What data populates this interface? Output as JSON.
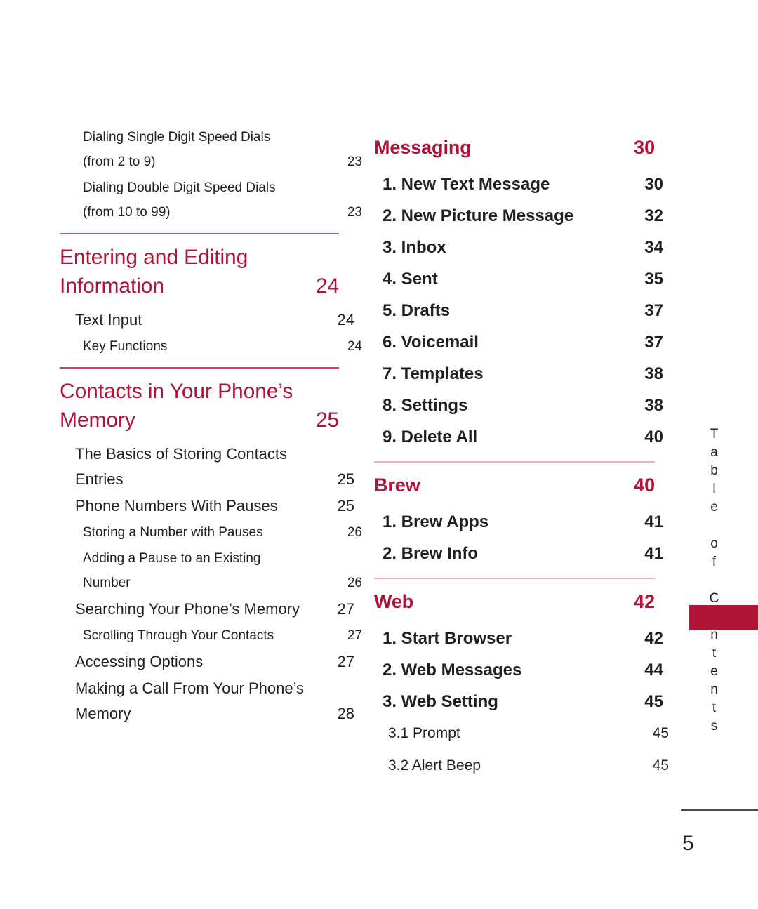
{
  "page": {
    "number": "5",
    "side_tab_label": "Table of Contents",
    "accent_color": "#b01538",
    "rule_color": "#c9456a",
    "light_rule_color": "#efafbc"
  },
  "left_column": [
    {
      "kind": "lv2-wrap",
      "line1": "Dialing Single Digit Speed Dials",
      "line2": "(from 2 to 9)",
      "page": "23"
    },
    {
      "kind": "lv2-wrap",
      "line1": "Dialing Double Digit Speed Dials",
      "line2": "(from 10 to 99)",
      "page": "23"
    },
    {
      "kind": "rule"
    },
    {
      "kind": "section-wrap",
      "line1": "Entering and Editing",
      "line2": "Information",
      "page": "24"
    },
    {
      "kind": "lv1",
      "label": "Text Input",
      "page": "24"
    },
    {
      "kind": "lv2",
      "label": "Key Functions",
      "page": "24"
    },
    {
      "kind": "rule"
    },
    {
      "kind": "section-wrap",
      "line1": "Contacts in Your Phone’s",
      "line2": "Memory",
      "page": "25"
    },
    {
      "kind": "lv1-wrap",
      "line1": "The Basics of Storing Contacts",
      "line2": "Entries",
      "page": "25"
    },
    {
      "kind": "lv1",
      "label": "Phone Numbers With Pauses",
      "page": "25"
    },
    {
      "kind": "lv2",
      "label": "Storing a Number with Pauses",
      "page": "26"
    },
    {
      "kind": "lv2-wrap",
      "line1": "Adding a Pause to an Existing",
      "line2": "Number",
      "page": "26"
    },
    {
      "kind": "lv1",
      "label": "Searching Your Phone’s Memory",
      "page": "27"
    },
    {
      "kind": "lv2",
      "label": "Scrolling Through Your Contacts",
      "page": "27"
    },
    {
      "kind": "lv1",
      "label": "Accessing Options",
      "page": "27"
    },
    {
      "kind": "lv1-wrap",
      "line1": "Making a Call From Your Phone’s",
      "line2": "Memory",
      "page": "28"
    }
  ],
  "right_column": [
    {
      "kind": "section-bold",
      "label": "Messaging",
      "page": "30"
    },
    {
      "kind": "num1",
      "label": "1. New Text Message",
      "page": "30"
    },
    {
      "kind": "num1",
      "label": "2. New Picture Message",
      "page": "32"
    },
    {
      "kind": "num1",
      "label": "3. Inbox",
      "page": "34"
    },
    {
      "kind": "num1",
      "label": "4. Sent",
      "page": "35"
    },
    {
      "kind": "num1",
      "label": "5. Drafts",
      "page": "37"
    },
    {
      "kind": "num1",
      "label": "6. Voicemail",
      "page": "37"
    },
    {
      "kind": "num1",
      "label": "7. Templates",
      "page": "38"
    },
    {
      "kind": "num1",
      "label": "8. Settings",
      "page": "38"
    },
    {
      "kind": "num1",
      "label": "9. Delete All",
      "page": "40"
    },
    {
      "kind": "rule-light"
    },
    {
      "kind": "section-bold",
      "label": "Brew",
      "page": "40"
    },
    {
      "kind": "num1",
      "label": "1. Brew Apps",
      "page": "41"
    },
    {
      "kind": "num1",
      "label": "2. Brew Info",
      "page": "41"
    },
    {
      "kind": "rule-light"
    },
    {
      "kind": "section-bold",
      "label": "Web",
      "page": "42"
    },
    {
      "kind": "num1",
      "label": "1. Start Browser",
      "page": "42"
    },
    {
      "kind": "num1",
      "label": "2. Web Messages",
      "page": "44"
    },
    {
      "kind": "num1",
      "label": "3. Web Setting",
      "page": "45"
    },
    {
      "kind": "num2",
      "label": "3.1 Prompt",
      "page": "45"
    },
    {
      "kind": "num2",
      "label": "3.2 Alert Beep",
      "page": "45"
    }
  ]
}
